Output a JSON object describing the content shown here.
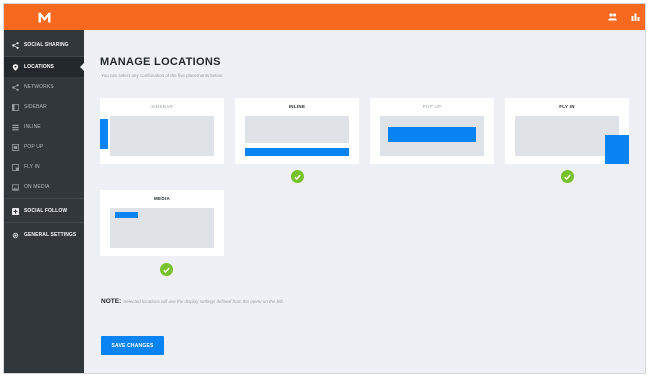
{
  "app": {
    "logo_icon": "m-logo-icon",
    "topbar_color": "#f7691f",
    "top_icons": [
      "users-icon",
      "bar-chart-icon"
    ]
  },
  "sidebar": {
    "items": [
      {
        "label": "SOCIAL SHARING",
        "icon": "share-icon",
        "type": "section"
      },
      {
        "label": "LOCATIONS",
        "icon": "location-icon",
        "type": "section",
        "active": true
      },
      {
        "label": "NETWORKS",
        "icon": "share-icon",
        "type": "sub"
      },
      {
        "label": "SIDEBAR",
        "icon": "sidebar-icon",
        "type": "sub"
      },
      {
        "label": "INLINE",
        "icon": "inline-icon",
        "type": "sub"
      },
      {
        "label": "POP UP",
        "icon": "popup-icon",
        "type": "sub"
      },
      {
        "label": "FLY IN",
        "icon": "flyin-icon",
        "type": "sub"
      },
      {
        "label": "ON MEDIA",
        "icon": "image-icon",
        "type": "sub"
      },
      {
        "label": "SOCIAL FOLLOW",
        "icon": "plus-icon",
        "type": "section"
      },
      {
        "label": "GENERAL SETTINGS",
        "icon": "gear-icon",
        "type": "section"
      }
    ]
  },
  "main": {
    "title": "MANAGE LOCATIONS",
    "subtitle": "You can select any combination of the five placements below.",
    "placements": [
      {
        "label": "SIDEBAR",
        "selected": false
      },
      {
        "label": "INLINE",
        "selected": true
      },
      {
        "label": "POP UP",
        "selected": false
      },
      {
        "label": "FLY IN",
        "selected": true
      },
      {
        "label": "MEDIA",
        "selected": true
      }
    ],
    "note_label": "NOTE:",
    "note_text": "Selected locations will use the display settings defined from the menu on the left.",
    "save_label": "SAVE CHANGES"
  },
  "colors": {
    "accent_blue": "#0a84f2",
    "check_green": "#77c12a",
    "sidebar_bg": "#32373c"
  }
}
